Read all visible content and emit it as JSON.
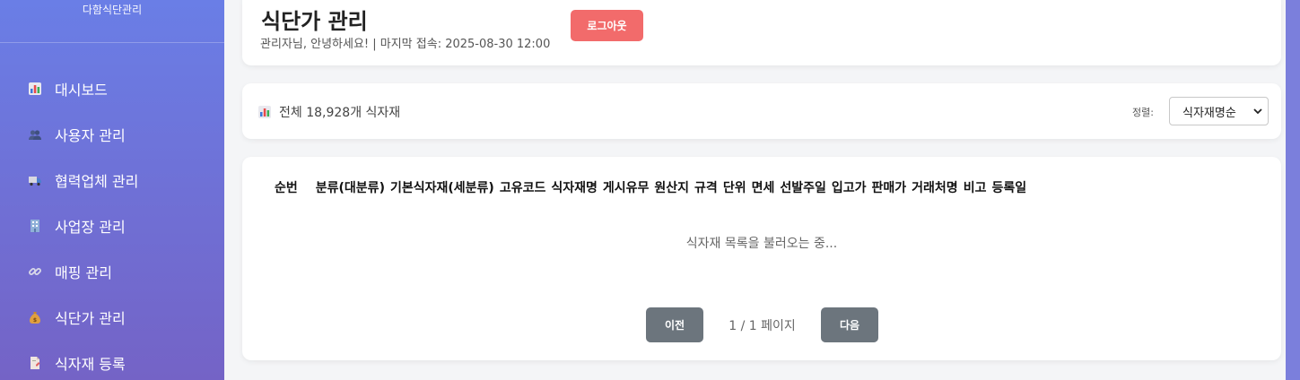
{
  "sidebar": {
    "brand": "다함식단관리",
    "items": [
      {
        "label": "대시보드",
        "icon": "chart-icon"
      },
      {
        "label": "사용자 관리",
        "icon": "users-icon"
      },
      {
        "label": "협력업체 관리",
        "icon": "truck-icon"
      },
      {
        "label": "사업장 관리",
        "icon": "building-icon"
      },
      {
        "label": "매핑 관리",
        "icon": "link-icon"
      },
      {
        "label": "식단가 관리",
        "icon": "money-bag-icon"
      },
      {
        "label": "식자재 등록",
        "icon": "document-icon"
      }
    ]
  },
  "header": {
    "title": "식단가 관리",
    "welcome": "관리자님, 안녕하세요! | 마지막 접속: 2025-08-30 12:00",
    "logout_label": "로그아웃"
  },
  "summary": {
    "text": "전체 18,928개 식자재",
    "sort_label": "정렬:",
    "sort_selected": "식자재명순"
  },
  "table": {
    "columns": [
      "순번",
      "분류(대분류)",
      "기본식자재(세분류)",
      "고유코드",
      "식자재명",
      "게시유무",
      "원산지",
      "규격",
      "단위",
      "면세",
      "선발주일",
      "입고가",
      "판매가",
      "거래처명",
      "비고",
      "등록일"
    ],
    "loading_text": "식자재 목록을 불러오는 중..."
  },
  "pagination": {
    "prev_label": "이전",
    "info": "1 / 1 페이지",
    "next_label": "다음"
  },
  "colors": {
    "sidebar_top": "#6a7ee6",
    "sidebar_bottom": "#7463c6",
    "logout": "#f26b6b",
    "pager_button": "#6c757d"
  }
}
